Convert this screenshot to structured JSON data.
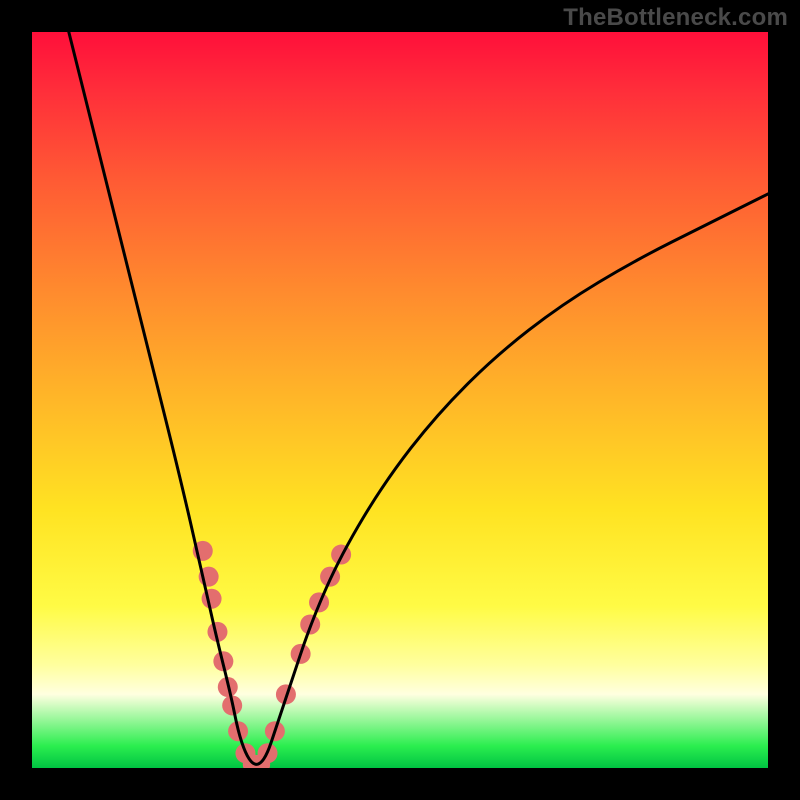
{
  "watermark": "TheBottleneck.com",
  "chart_data": {
    "type": "line",
    "title": "",
    "xlabel": "",
    "ylabel": "",
    "xlim": [
      0,
      100
    ],
    "ylim": [
      0,
      100
    ],
    "curve": {
      "name": "bottleneck-curve",
      "x": [
        5,
        8,
        12,
        16,
        20,
        23,
        25,
        27,
        28,
        29,
        30,
        31,
        32,
        33,
        35,
        38,
        42,
        48,
        55,
        63,
        72,
        82,
        92,
        100
      ],
      "y": [
        100,
        88,
        72,
        56,
        40,
        27,
        18,
        10,
        5,
        2,
        0.5,
        0.5,
        2,
        5,
        11,
        20,
        29,
        39,
        48,
        56,
        63,
        69,
        74,
        78
      ]
    },
    "markers": [
      {
        "x": 23.2,
        "y": 29.5
      },
      {
        "x": 24.0,
        "y": 26.0
      },
      {
        "x": 24.4,
        "y": 23.0
      },
      {
        "x": 25.2,
        "y": 18.5
      },
      {
        "x": 26.0,
        "y": 14.5
      },
      {
        "x": 26.6,
        "y": 11.0
      },
      {
        "x": 27.2,
        "y": 8.5
      },
      {
        "x": 28.0,
        "y": 5.0
      },
      {
        "x": 29.0,
        "y": 2.0
      },
      {
        "x": 30.0,
        "y": 0.5
      },
      {
        "x": 31.0,
        "y": 0.5
      },
      {
        "x": 32.0,
        "y": 2.0
      },
      {
        "x": 33.0,
        "y": 5.0
      },
      {
        "x": 34.5,
        "y": 10.0
      },
      {
        "x": 36.5,
        "y": 15.5
      },
      {
        "x": 37.8,
        "y": 19.5
      },
      {
        "x": 39.0,
        "y": 22.5
      },
      {
        "x": 40.5,
        "y": 26.0
      },
      {
        "x": 42.0,
        "y": 29.0
      }
    ],
    "marker_style": {
      "fill": "#e36e6e",
      "r": 10
    },
    "background_gradient": {
      "top": "#ff0f3a",
      "upper_mid": "#ffb728",
      "lower_mid": "#ffff9e",
      "bottom": "#00c342"
    }
  }
}
